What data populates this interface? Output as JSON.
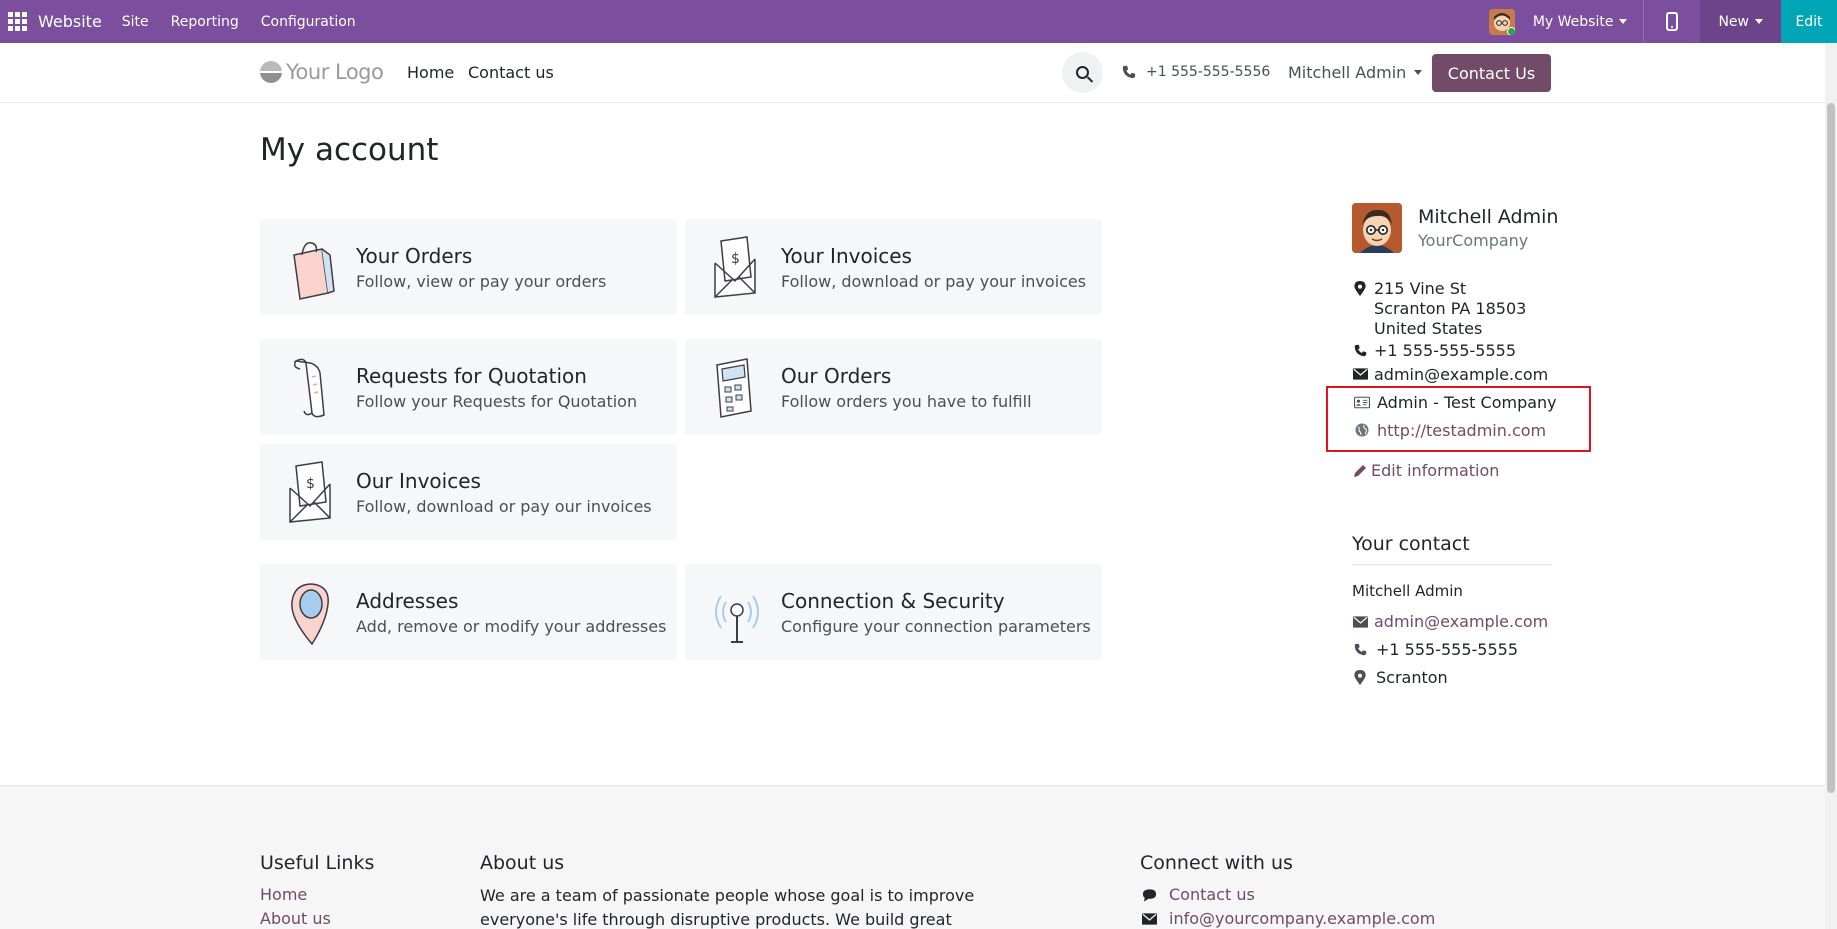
{
  "topbar": {
    "brand": "Website",
    "menus": [
      "Site",
      "Reporting",
      "Configuration"
    ],
    "website_selector": "My Website",
    "new_label": "New",
    "edit_label": "Edit"
  },
  "header": {
    "logo_text": "Your Logo",
    "nav": [
      "Home",
      "Contact us"
    ],
    "phone": "+1 555-555-5556",
    "user": "Mitchell Admin",
    "contact_button": "Contact Us"
  },
  "page": {
    "title": "My account"
  },
  "cards": [
    {
      "title": "Your Orders",
      "desc": "Follow, view or pay your orders",
      "icon": "shopping-bag-icon"
    },
    {
      "title": "Your Invoices",
      "desc": "Follow, download or pay your invoices",
      "icon": "invoice-envelope-icon"
    },
    {
      "title": "Requests for Quotation",
      "desc": "Follow your Requests for Quotation",
      "icon": "scroll-icon"
    },
    {
      "title": "Our Orders",
      "desc": "Follow orders you have to fulfill",
      "icon": "calculator-icon"
    },
    {
      "title": "Our Invoices",
      "desc": "Follow, download or pay our invoices",
      "icon": "invoice-envelope-icon"
    },
    {
      "title": "Addresses",
      "desc": "Add, remove or modify your addresses",
      "icon": "map-pin-icon"
    },
    {
      "title": "Connection & Security",
      "desc": "Configure your connection parameters",
      "icon": "antenna-icon"
    }
  ],
  "profile": {
    "name": "Mitchell Admin",
    "company": "YourCompany",
    "street": "215 Vine St",
    "city_line": "Scranton PA 18503",
    "country": "United States",
    "phone": "+1 555-555-5555",
    "email": "admin@example.com",
    "company_name": "Admin - Test Company",
    "website": "http://testadmin.com",
    "edit_label": "Edit information"
  },
  "your_contact": {
    "heading": "Your contact",
    "name": "Mitchell Admin",
    "email": "admin@example.com",
    "phone": "+1 555-555-5555",
    "city": "Scranton"
  },
  "footer": {
    "useful_links_heading": "Useful Links",
    "useful_links": [
      "Home",
      "About us"
    ],
    "about_heading": "About us",
    "about_text": "We are a team of passionate people whose goal is to improve everyone's life through disruptive products. We build great products",
    "connect_heading": "Connect with us",
    "connect_contact": "Contact us",
    "connect_email": "info@yourcompany.example.com"
  },
  "colors": {
    "topbar": "#7c4f9e",
    "brand_primary": "#714b67",
    "edit_teal": "#00a5b6",
    "highlight": "#e3131b"
  }
}
